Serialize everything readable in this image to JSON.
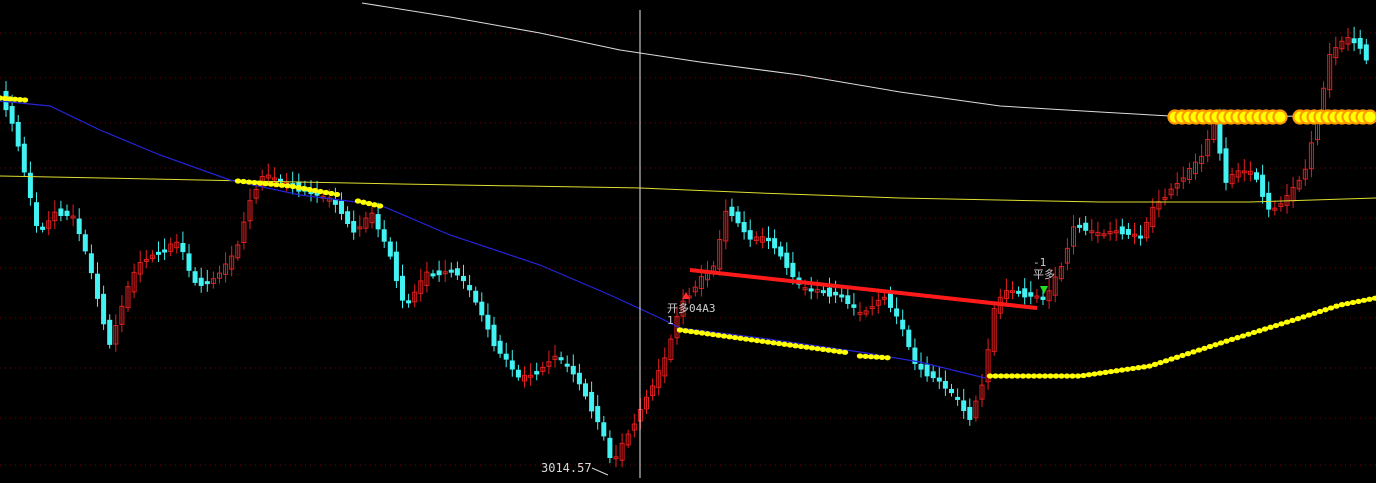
{
  "chart_data": {
    "type": "candlestick",
    "low_label": "3014.57",
    "signals": [
      {
        "sub": "1",
        "text": "开多04A3",
        "direction": "up",
        "color": "#ff2a2a"
      },
      {
        "sub": "-1",
        "text": "平多",
        "direction": "down",
        "color": "#22dd22"
      }
    ],
    "colors": {
      "background": "#000000",
      "candle_up": "#e21f1f",
      "candle_down": "#43f2f2",
      "ma_white": "#dcdcdc",
      "ma_yellow": "#dede30",
      "ma_blue": "#2424d8",
      "dots": "#ffff00",
      "big_dots": "#ff9900",
      "trend_line": "#ff1a1a",
      "grid": "#7a0000",
      "crosshair": "#e8e8e8"
    },
    "grid": true
  }
}
